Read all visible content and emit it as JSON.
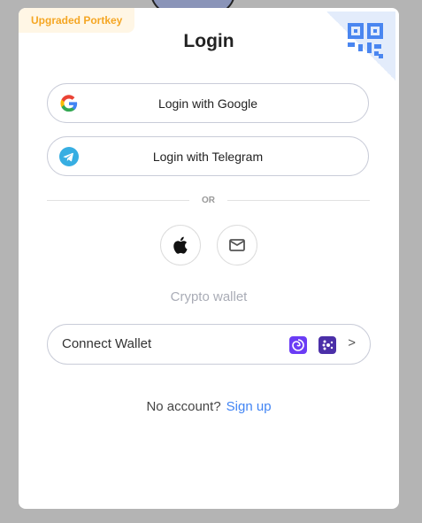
{
  "badge": "Upgraded Portkey",
  "title": "Login",
  "google_label": "Login with Google",
  "telegram_label": "Login with Telegram",
  "or_label": "OR",
  "crypto_label": "Crypto wallet",
  "connect_wallet_label": "Connect Wallet",
  "no_account": "No account?",
  "sign_up": "Sign up",
  "colors": {
    "accent": "#4285f4",
    "badge": "#f5a623"
  }
}
